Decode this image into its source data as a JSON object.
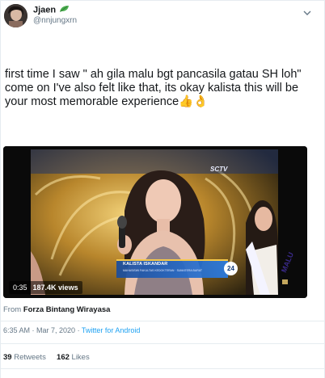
{
  "author": {
    "display_name": "Jjaen",
    "handle": "@nnjungxrn",
    "avatar_icon": "avatar-photo",
    "badge_icon": "leaf-emoji"
  },
  "tweet": {
    "text": "first time I saw \" ah gila malu bgt pancasila gatau SH loh\"\ncome on I've also felt like that, its okay kalista this will be your most memorable experience👍👌",
    "menu_icon": "chevron-down-icon"
  },
  "media": {
    "duration": "0:35",
    "views": "187.4K views",
    "lower_third_name": "KALISTA ISKANDAR",
    "lower_third_subtitle": "MAHASISWI FAKULTAS KEDOKTERAN · SUMATERA BARAT",
    "contestant_number": "24",
    "channel_logo": "SCTV",
    "sash_text": "MALU"
  },
  "source": {
    "prefix": "From",
    "name": "Forza Bintang Wirayasa"
  },
  "meta": {
    "time": "6:35 AM",
    "date": "Mar 7, 2020",
    "client": "Twitter for Android"
  },
  "stats": {
    "retweets_count": "39",
    "retweets_label": "Retweets",
    "likes_count": "162",
    "likes_label": "Likes"
  },
  "colors": {
    "accent": "#1da1f2",
    "secondary_text": "#657786",
    "divider": "#e6ecf0"
  }
}
